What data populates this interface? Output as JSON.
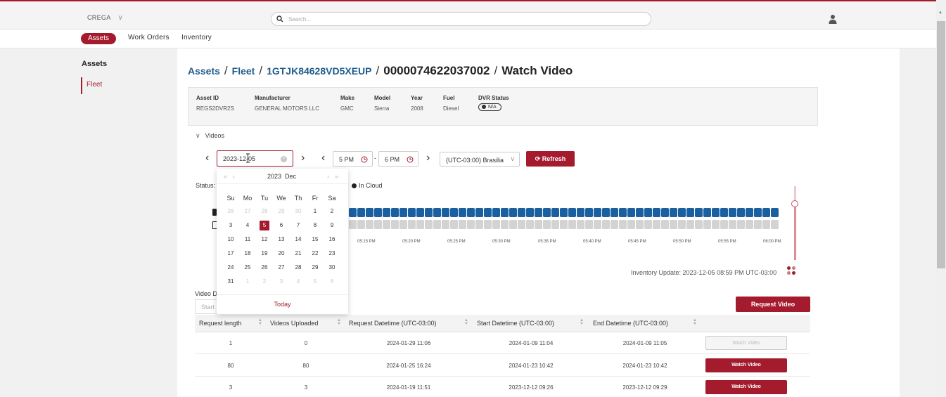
{
  "app": {
    "org_name": "CREGA",
    "search_placeholder": "Search..."
  },
  "nav": {
    "tabs": [
      "Assets",
      "Work Orders",
      "Inventory"
    ],
    "active": "Assets"
  },
  "sidebar": {
    "title": "Assets",
    "items": [
      {
        "label": "Fleet"
      }
    ]
  },
  "breadcrumb": {
    "assets": "Assets",
    "fleet": "Fleet",
    "vin": "1GTJK84628VD5XEUP",
    "device": "0000074622037002",
    "page": "Watch Video"
  },
  "asset": {
    "labels": [
      "Asset ID",
      "Manufacturer",
      "Make",
      "Model",
      "Year",
      "Fuel",
      "DVR Status"
    ],
    "values": [
      "REGS2DVR2S",
      "GENERAL MOTORS LLC",
      "GMC",
      "Sierra",
      "2008",
      "Diesel"
    ],
    "dvr_status": "N/A"
  },
  "videos": {
    "section_label": "Videos",
    "date_value": "2023-12-05",
    "start_time": "5 PM",
    "end_time": "6 PM",
    "time_sep": "-",
    "timezone": "(UTC-03:00) Brasilia",
    "refresh_label": "Refresh",
    "status_label": "Status:",
    "legend_cloud": "In Cloud",
    "ticks": [
      "05:15 PM",
      "05:20 PM",
      "05:25 PM",
      "05:30 PM",
      "05:35 PM",
      "05:40 PM",
      "05:45 PM",
      "05:50 PM",
      "05:55 PM",
      "06:00 PM"
    ],
    "inventory_update": "Inventory Update: 2023-12-05 08:59 PM UTC-03:00",
    "video_d_label": "Video D",
    "start_placeholder": "Start",
    "request_button": "Request Video",
    "colors": {
      "uploaded": "#1a5fa0",
      "not_uploaded": "#d3d3d3",
      "accent": "#a51b2e"
    }
  },
  "calendar": {
    "year": "2023",
    "month": "Dec",
    "weekdays": [
      "Su",
      "Mo",
      "Tu",
      "We",
      "Th",
      "Fr",
      "Sa"
    ],
    "days": [
      [
        "26",
        "27",
        "28",
        "29",
        "30",
        "1",
        "2"
      ],
      [
        "3",
        "4",
        "5",
        "6",
        "7",
        "8",
        "9"
      ],
      [
        "10",
        "11",
        "12",
        "13",
        "14",
        "15",
        "16"
      ],
      [
        "17",
        "18",
        "19",
        "20",
        "21",
        "22",
        "23"
      ],
      [
        "24",
        "25",
        "26",
        "27",
        "28",
        "29",
        "30"
      ],
      [
        "31",
        "1",
        "2",
        "3",
        "4",
        "5",
        "6"
      ]
    ],
    "selected": "5",
    "today_label": "Today"
  },
  "table": {
    "headers": [
      "Request length",
      "Videos Uploaded",
      "Request Datetime (UTC-03:00)",
      "Start Datetime (UTC-03:00)",
      "End Datetime (UTC-03:00)"
    ],
    "rows": [
      {
        "length": "1",
        "uploaded": "0",
        "request": "2024-01-29 11:06",
        "start": "2024-01-09 11:04",
        "end": "2024-01-09 11:05",
        "action": "Watch Video",
        "enabled": false
      },
      {
        "length": "80",
        "uploaded": "80",
        "request": "2024-01-25 16:24",
        "start": "2024-01-23 10:42",
        "end": "2024-01-23 10:42",
        "action": "Watch Video",
        "enabled": true
      },
      {
        "length": "3",
        "uploaded": "3",
        "request": "2024-01-19 11:51",
        "start": "2023-12-12 09:26",
        "end": "2023-12-12 09:29",
        "action": "Watch Video",
        "enabled": true
      }
    ]
  }
}
